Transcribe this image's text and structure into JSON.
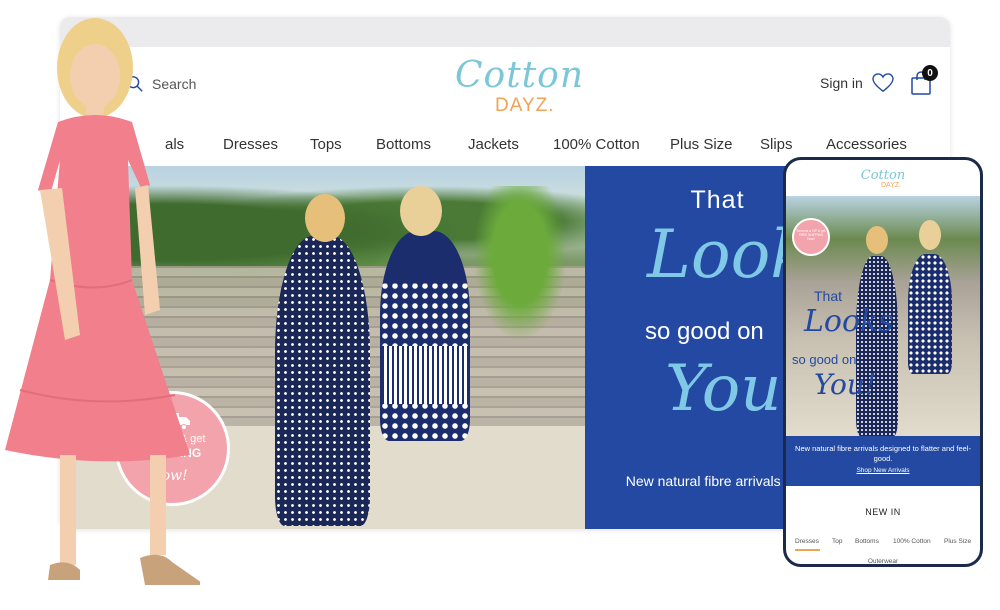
{
  "header": {
    "search_label": "Search",
    "logo_script": "Cotton",
    "logo_word": "DAYZ.",
    "sign_in": "Sign in",
    "cart_count": "0"
  },
  "nav": {
    "items": [
      "als",
      "Dresses",
      "Tops",
      "Bottoms",
      "Jackets",
      "100% Cotton",
      "Plus Size",
      "Slips",
      "Accessories"
    ]
  },
  "hero": {
    "promo_line1": "E  a VIP & get",
    "promo_line2": "SHIPPING",
    "promo_now": "low!",
    "headline_that": "That",
    "headline_looks": "Looks",
    "headline_sogood": "so good on",
    "headline_you": "You!",
    "subline": "New natural fibre arrivals d  to flatter and feel-good"
  },
  "mobile": {
    "logo_script": "Cotton",
    "logo_word": "DAYZ.",
    "promo": "Become a VIP & get FREE SHIPPING Now!",
    "headline_that": "That",
    "headline_looks": "Looks",
    "headline_sogood": "so good on",
    "headline_you": "You!",
    "subline": "New natural fibre arrivals designed to flatter and feel-good.",
    "shop_link": "Shop New Arrivals",
    "section_title": "NEW IN",
    "tabs": [
      "Dresses",
      "Top",
      "Bottoms",
      "100% Cotton",
      "Plus Size"
    ],
    "tab_overflow": "Outerwear"
  },
  "colors": {
    "brand_blue": "#2349a3",
    "script_blue": "#7fc8e6",
    "logo_teal": "#7bc6d8",
    "logo_orange": "#f0a356",
    "promo_pink": "#f2a3ab",
    "dress_pink": "#f17f8c"
  }
}
